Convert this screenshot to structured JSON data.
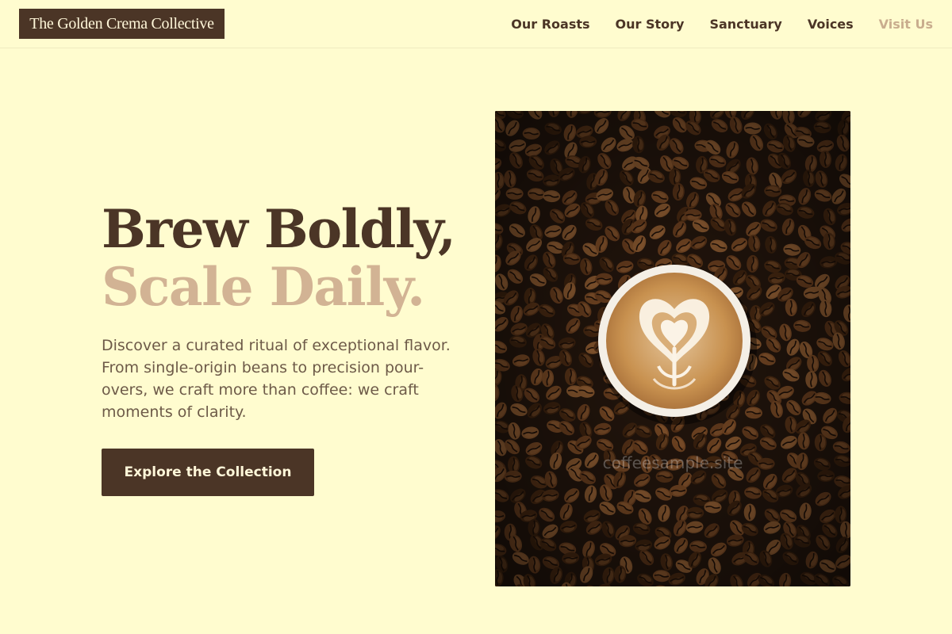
{
  "header": {
    "brand": "The Golden Crema Collective",
    "nav": [
      {
        "label": "Our Roasts"
      },
      {
        "label": "Our Story"
      },
      {
        "label": "Sanctuary"
      },
      {
        "label": "Voices"
      },
      {
        "label": "Visit Us"
      }
    ]
  },
  "hero": {
    "title_line_1": "Brew Boldly,",
    "title_line_2": "Scale Daily.",
    "body": "Discover a curated ritual of exceptional flavor. From single-origin beans to precision pour-overs, we craft more than coffee: we craft moments of clarity.",
    "cta_label": "Explore the Collection"
  },
  "image": {
    "alt": "Latte art heart in a white cup on a bed of roasted coffee beans",
    "watermark": "coffeesample.site"
  },
  "colors": {
    "background": "#FFFCCF",
    "brand_brown": "#4B3526",
    "accent_tan": "#D2B394",
    "body_text": "#6D5A48",
    "muted_nav": "#C9AD8E",
    "cream_text": "#FFF7D9"
  }
}
